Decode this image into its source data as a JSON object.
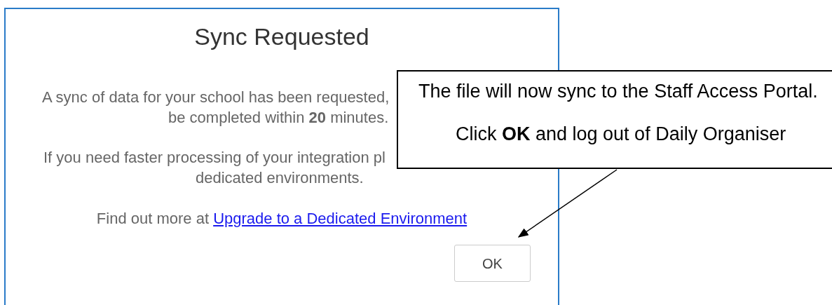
{
  "dialog": {
    "title": "Sync Requested",
    "paragraphs": [
      [
        "A sync of data for your school has been requested,",
        "be completed within **20** minutes."
      ],
      [
        "If you need faster processing of your integration pl",
        "dedicated environments."
      ]
    ],
    "more_text": "Find out more at",
    "link": "Upgrade to a Dedicated Environment",
    "button": "OK"
  },
  "callout": {
    "lines": [
      "The file will now sync to the Staff Access Portal.",
      "Click **OK** and log out of Daily Organiser"
    ]
  }
}
